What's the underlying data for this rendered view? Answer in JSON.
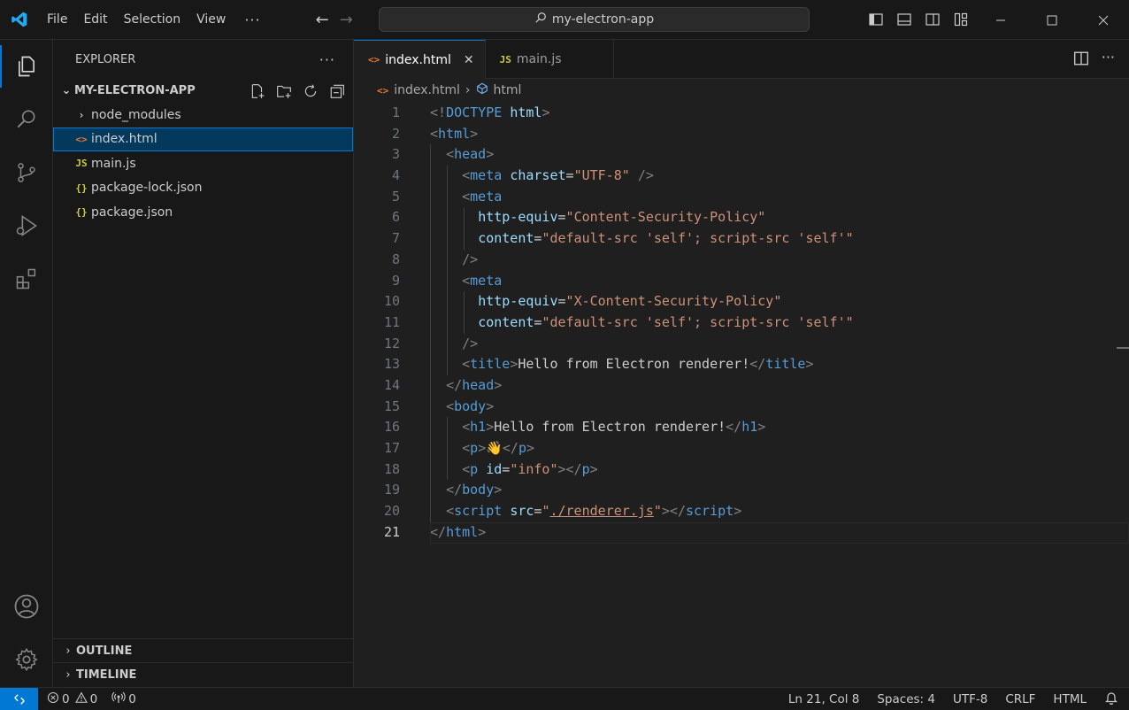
{
  "titlebar": {
    "menu": [
      "File",
      "Edit",
      "Selection",
      "View"
    ],
    "more": "···",
    "search_text": "my-electron-app"
  },
  "activity": [
    "explorer-icon",
    "search-icon",
    "source-control-icon",
    "run-debug-icon",
    "extensions-icon",
    "accounts-icon",
    "manage-gear-icon"
  ],
  "sidebar": {
    "title": "EXPLORER",
    "more": "···",
    "folder": "MY-ELECTRON-APP",
    "items": [
      {
        "icon": "›",
        "label": "node_modules"
      },
      {
        "icon": "<>",
        "label": "index.html"
      },
      {
        "icon": "JS",
        "label": "main.js"
      },
      {
        "icon": "{}",
        "label": "package-lock.json"
      },
      {
        "icon": "{}",
        "label": "package.json"
      }
    ],
    "outline": "OUTLINE",
    "timeline": "TIMELINE"
  },
  "editor": {
    "tabs": [
      {
        "icon": "<>",
        "label": "index.html"
      },
      {
        "icon": "JS",
        "label": "main.js"
      }
    ],
    "breadcrumb": {
      "file": "index.html",
      "symbol": "html"
    },
    "current_line": 21
  },
  "code_lines": [
    "1",
    "2",
    "3",
    "4",
    "5",
    "6",
    "7",
    "8",
    "9",
    "10",
    "11",
    "12",
    "13",
    "14",
    "15",
    "16",
    "17",
    "18",
    "19",
    "20",
    "21"
  ],
  "code_text": {
    "title_text": "Hello from Electron renderer!",
    "h1_text": "Hello from Electron renderer!",
    "p_emoji": "👋",
    "csp_1": "Content-Security-Policy",
    "csp_2": "X-Content-Security-Policy",
    "csp_content": "default-src 'self'; script-src 'self'",
    "charset": "UTF-8",
    "info_id": "info",
    "script_src": "./renderer.js"
  },
  "statusbar": {
    "errors": "0",
    "warnings": "0",
    "ports": "0",
    "position": "Ln 21, Col 8",
    "spaces": "Spaces: 4",
    "encoding": "UTF-8",
    "eol": "CRLF",
    "language": "HTML"
  },
  "colors": {
    "accent": "#0078d4",
    "tag": "#569cd6",
    "attr": "#9cdcfe",
    "string": "#ce9178"
  }
}
